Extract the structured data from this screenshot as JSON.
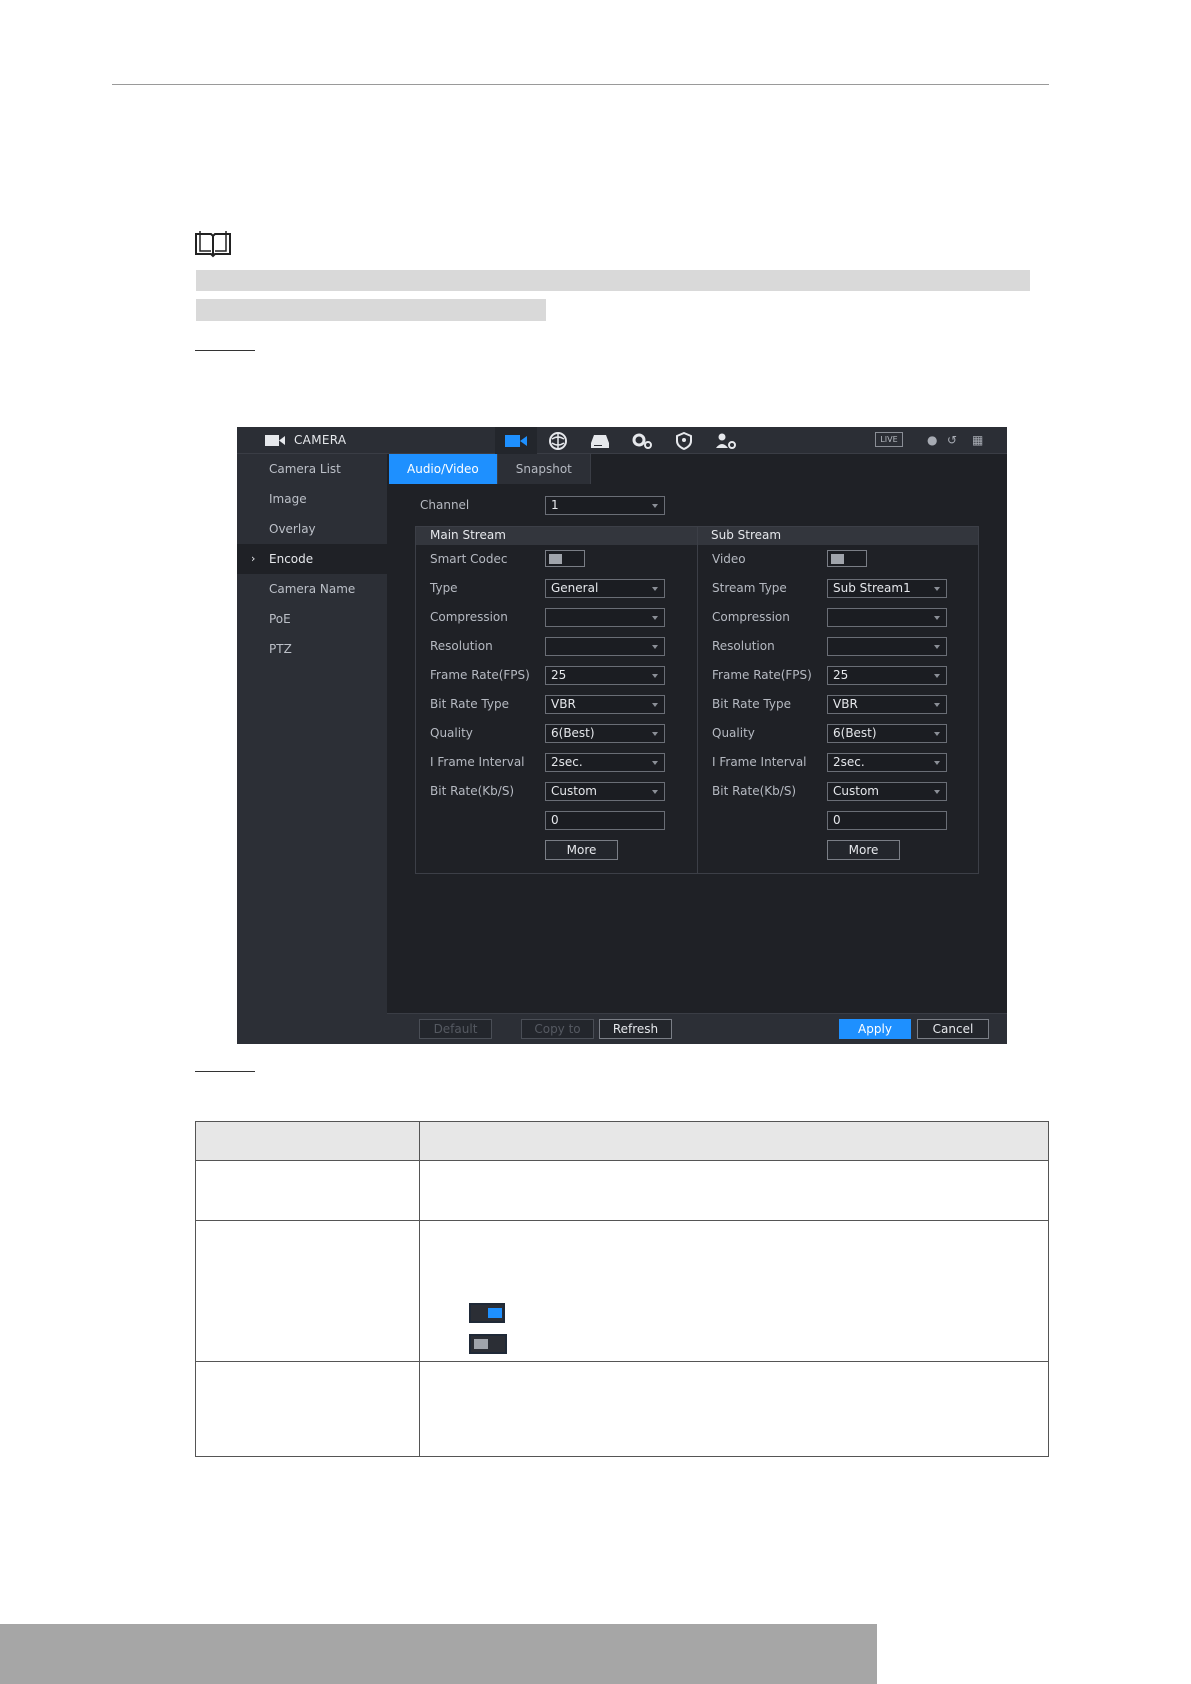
{
  "app": {
    "title": "CAMERA",
    "live_badge": "LIVE",
    "top_icons": [
      "camera-icon",
      "network-icon",
      "storage-icon",
      "system-gear-icon",
      "security-shield-icon",
      "account-icon"
    ]
  },
  "sidebar": {
    "items": [
      {
        "label": "Camera List",
        "active": false
      },
      {
        "label": "Image",
        "active": false
      },
      {
        "label": "Overlay",
        "active": false
      },
      {
        "label": "Encode",
        "active": true
      },
      {
        "label": "Camera Name",
        "active": false
      },
      {
        "label": "PoE",
        "active": false
      },
      {
        "label": "PTZ",
        "active": false
      }
    ]
  },
  "tabs": [
    {
      "label": "Audio/Video",
      "active": true
    },
    {
      "label": "Snapshot",
      "active": false
    }
  ],
  "channel": {
    "label": "Channel",
    "value": "1"
  },
  "main_stream": {
    "title": "Main Stream",
    "smart_codec_label": "Smart Codec",
    "smart_codec_on": false,
    "type_label": "Type",
    "type_value": "General",
    "compression_label": "Compression",
    "compression_value": "",
    "resolution_label": "Resolution",
    "resolution_value": "",
    "frame_rate_label": "Frame Rate(FPS)",
    "frame_rate_value": "25",
    "bit_rate_type_label": "Bit Rate Type",
    "bit_rate_type_value": "VBR",
    "quality_label": "Quality",
    "quality_value": "6(Best)",
    "i_frame_label": "I Frame Interval",
    "i_frame_value": "2sec.",
    "bit_rate_label": "Bit Rate(Kb/S)",
    "bit_rate_value": "Custom",
    "custom_value": "0",
    "more_label": "More"
  },
  "sub_stream": {
    "title": "Sub Stream",
    "video_label": "Video",
    "video_on": false,
    "stream_type_label": "Stream Type",
    "stream_type_value": "Sub Stream1",
    "compression_label": "Compression",
    "compression_value": "",
    "resolution_label": "Resolution",
    "resolution_value": "",
    "frame_rate_label": "Frame Rate(FPS)",
    "frame_rate_value": "25",
    "bit_rate_type_label": "Bit Rate Type",
    "bit_rate_type_value": "VBR",
    "quality_label": "Quality",
    "quality_value": "6(Best)",
    "i_frame_label": "I Frame Interval",
    "i_frame_value": "2sec.",
    "bit_rate_label": "Bit Rate(Kb/S)",
    "bit_rate_value": "Custom",
    "custom_value": "0",
    "more_label": "More"
  },
  "footer_buttons": {
    "default": "Default",
    "copy_to": "Copy to",
    "refresh": "Refresh",
    "apply": "Apply",
    "cancel": "Cancel"
  },
  "colors": {
    "accent": "#1e90ff",
    "panel_bg": "#1f2126",
    "sidebar_bg": "#2c2f36",
    "highlight_gray": "#d9d9d9"
  }
}
